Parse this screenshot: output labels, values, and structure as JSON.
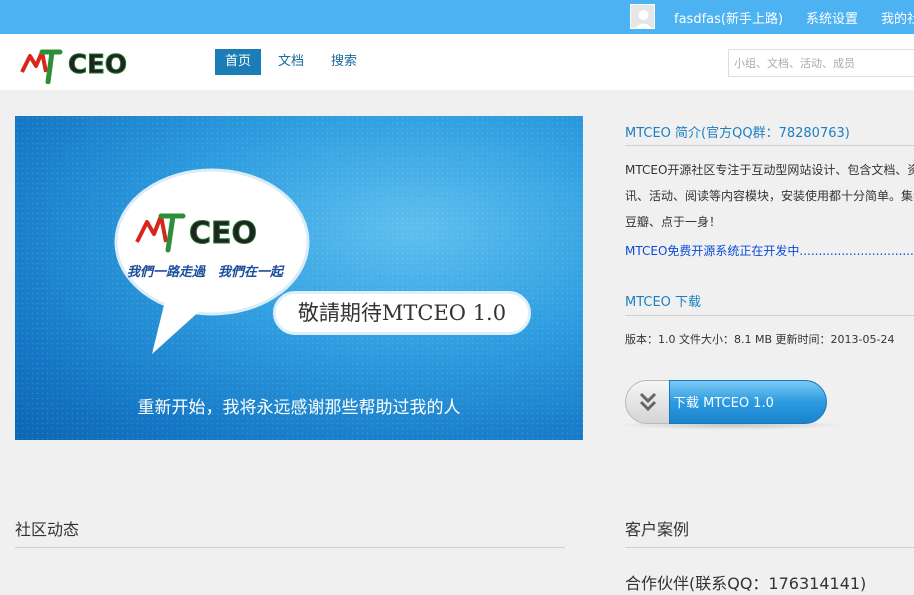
{
  "topbar": {
    "username": "fasdfas(新手上路)",
    "settings": "系统设置",
    "mine": "我的社"
  },
  "header": {
    "logo_text": "MTCEO",
    "nav": [
      {
        "label": "首页",
        "active": true
      },
      {
        "label": "文档",
        "active": false
      },
      {
        "label": "搜索",
        "active": false
      }
    ],
    "search_placeholder": "小组、文档、活动、成员"
  },
  "banner": {
    "logo_text": "MTCEO",
    "slogan": "我們一路走過　我們在一起",
    "pill_text": "敬請期待MTCEO 1.0",
    "tagline": "重新开始，我将永远感谢那些帮助过我的人"
  },
  "intro": {
    "title": "MTCEO 简介(官方QQ群：78280763)",
    "body": "MTCEO开源社区专注于互动型网站设计、包含文档、资讯、活动、阅读等内容模块，安装使用都十分简单。集合豆瓣、点于一身！",
    "link": "MTCEO免费开源系统正在开发中",
    "link_dots": "..............................."
  },
  "download": {
    "title": "MTCEO 下载",
    "meta": "版本：1.0  文件大小：8.1 MB  更新时间：2013-05-24",
    "button_label": "下载 MTCEO 1.0"
  },
  "sections": {
    "community": "社区动态",
    "cases": "客户案例",
    "partner": "合作伙伴(联系QQ：176314141)"
  },
  "colors": {
    "topbar": "#4cb2f2",
    "accent": "#1d7fc3",
    "nav_active": "#1a7db5"
  }
}
